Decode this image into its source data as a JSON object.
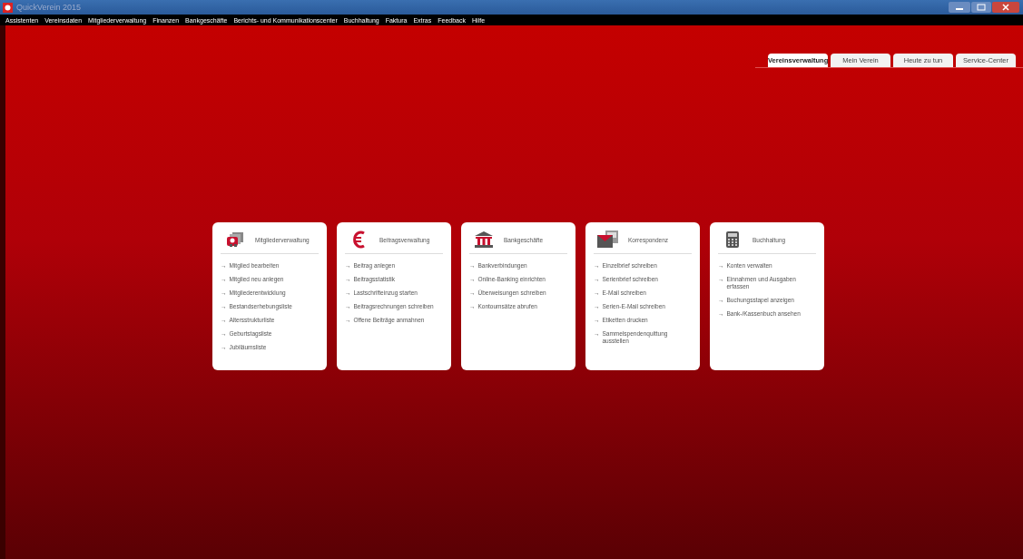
{
  "window": {
    "title": "QuickVerein 2015"
  },
  "menu": [
    "Assistenten",
    "Vereinsdaten",
    "Mitgliederverwaltung",
    "Finanzen",
    "Bankgeschäfte",
    "Berichts- und Kommunikationscenter",
    "Buchhaltung",
    "Faktura",
    "Extras",
    "Feedback",
    "Hilfe"
  ],
  "tabs": [
    {
      "label": "Vereinsverwaltung",
      "selected": true
    },
    {
      "label": "Mein Verein",
      "selected": false
    },
    {
      "label": "Heute zu tun",
      "selected": false
    },
    {
      "label": "Service-Center",
      "selected": false
    }
  ],
  "cards": [
    {
      "title": "Mitgliederverwaltung",
      "kind": "members",
      "items": [
        {
          "arrow": "→",
          "label": "Mitglied bearbeiten"
        },
        {
          "arrow": "→",
          "label": "Mitglied neu anlegen"
        },
        {
          "arrow": "→",
          "label": "Mitgliederentwicklung"
        },
        {
          "arrow": "→",
          "label": "Bestandserhebungsliste"
        },
        {
          "arrow": "→",
          "label": "Altersstrukturliste"
        },
        {
          "arrow": "→",
          "label": "Geburtstagsliste"
        },
        {
          "arrow": "→",
          "label": "Jubiläumsliste"
        }
      ]
    },
    {
      "title": "Beitragsverwaltung",
      "kind": "euro",
      "items": [
        {
          "arrow": "→",
          "label": "Beitrag anlegen"
        },
        {
          "arrow": "→",
          "label": "Beitragsstatistik"
        },
        {
          "arrow": "→",
          "label": "Lastschrifteinzug starten"
        },
        {
          "arrow": "→",
          "label": "Beitragsrechnungen schreiben"
        },
        {
          "arrow": "→",
          "label": "Offene Beiträge anmahnen"
        }
      ]
    },
    {
      "title": "Bankgeschäfte",
      "kind": "bank",
      "items": [
        {
          "arrow": "→",
          "label": "Bankverbindungen"
        },
        {
          "arrow": "→",
          "label": "Online-Banking einrichten"
        },
        {
          "arrow": "→",
          "label": "Überweisungen schreiben"
        },
        {
          "arrow": "→",
          "label": "Kontoumsätze abrufen"
        }
      ]
    },
    {
      "title": "Korrespondenz",
      "kind": "mail",
      "items": [
        {
          "arrow": "→",
          "label": "Einzelbrief schreiben"
        },
        {
          "arrow": "→",
          "label": "Serienbrief schreiben"
        },
        {
          "arrow": "→",
          "label": "E-Mail schreiben"
        },
        {
          "arrow": "→",
          "label": "Serien-E-Mail schreiben"
        },
        {
          "arrow": "→",
          "label": "Etiketten drucken"
        },
        {
          "arrow": "→",
          "label": "Sammelspendenquittung ausstellen"
        }
      ]
    },
    {
      "title": "Buchhaltung",
      "kind": "calculator",
      "items": [
        {
          "arrow": "→",
          "label": "Konten verwalten"
        },
        {
          "arrow": "→",
          "label": "Einnahmen und Ausgaben erfassen"
        },
        {
          "arrow": "→",
          "label": "Buchungsstapel anzeigen"
        },
        {
          "arrow": "→",
          "label": "Bank-/Kassenbuch ansehen"
        }
      ]
    }
  ]
}
